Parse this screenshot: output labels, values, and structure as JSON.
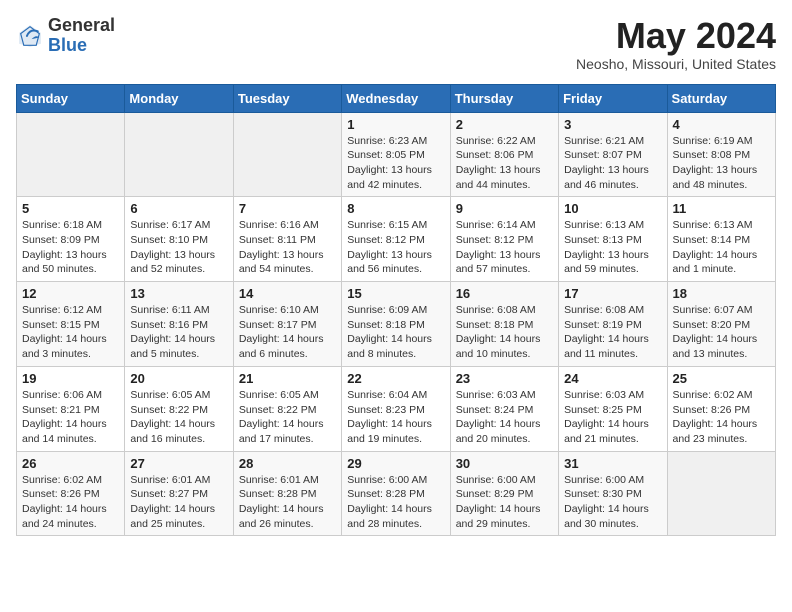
{
  "header": {
    "logo_line1": "General",
    "logo_line2": "Blue",
    "month_title": "May 2024",
    "location": "Neosho, Missouri, United States"
  },
  "weekdays": [
    "Sunday",
    "Monday",
    "Tuesday",
    "Wednesday",
    "Thursday",
    "Friday",
    "Saturday"
  ],
  "weeks": [
    [
      {
        "day": "",
        "sunrise": "",
        "sunset": "",
        "daylight": ""
      },
      {
        "day": "",
        "sunrise": "",
        "sunset": "",
        "daylight": ""
      },
      {
        "day": "",
        "sunrise": "",
        "sunset": "",
        "daylight": ""
      },
      {
        "day": "1",
        "sunrise": "Sunrise: 6:23 AM",
        "sunset": "Sunset: 8:05 PM",
        "daylight": "Daylight: 13 hours and 42 minutes."
      },
      {
        "day": "2",
        "sunrise": "Sunrise: 6:22 AM",
        "sunset": "Sunset: 8:06 PM",
        "daylight": "Daylight: 13 hours and 44 minutes."
      },
      {
        "day": "3",
        "sunrise": "Sunrise: 6:21 AM",
        "sunset": "Sunset: 8:07 PM",
        "daylight": "Daylight: 13 hours and 46 minutes."
      },
      {
        "day": "4",
        "sunrise": "Sunrise: 6:19 AM",
        "sunset": "Sunset: 8:08 PM",
        "daylight": "Daylight: 13 hours and 48 minutes."
      }
    ],
    [
      {
        "day": "5",
        "sunrise": "Sunrise: 6:18 AM",
        "sunset": "Sunset: 8:09 PM",
        "daylight": "Daylight: 13 hours and 50 minutes."
      },
      {
        "day": "6",
        "sunrise": "Sunrise: 6:17 AM",
        "sunset": "Sunset: 8:10 PM",
        "daylight": "Daylight: 13 hours and 52 minutes."
      },
      {
        "day": "7",
        "sunrise": "Sunrise: 6:16 AM",
        "sunset": "Sunset: 8:11 PM",
        "daylight": "Daylight: 13 hours and 54 minutes."
      },
      {
        "day": "8",
        "sunrise": "Sunrise: 6:15 AM",
        "sunset": "Sunset: 8:12 PM",
        "daylight": "Daylight: 13 hours and 56 minutes."
      },
      {
        "day": "9",
        "sunrise": "Sunrise: 6:14 AM",
        "sunset": "Sunset: 8:12 PM",
        "daylight": "Daylight: 13 hours and 57 minutes."
      },
      {
        "day": "10",
        "sunrise": "Sunrise: 6:13 AM",
        "sunset": "Sunset: 8:13 PM",
        "daylight": "Daylight: 13 hours and 59 minutes."
      },
      {
        "day": "11",
        "sunrise": "Sunrise: 6:13 AM",
        "sunset": "Sunset: 8:14 PM",
        "daylight": "Daylight: 14 hours and 1 minute."
      }
    ],
    [
      {
        "day": "12",
        "sunrise": "Sunrise: 6:12 AM",
        "sunset": "Sunset: 8:15 PM",
        "daylight": "Daylight: 14 hours and 3 minutes."
      },
      {
        "day": "13",
        "sunrise": "Sunrise: 6:11 AM",
        "sunset": "Sunset: 8:16 PM",
        "daylight": "Daylight: 14 hours and 5 minutes."
      },
      {
        "day": "14",
        "sunrise": "Sunrise: 6:10 AM",
        "sunset": "Sunset: 8:17 PM",
        "daylight": "Daylight: 14 hours and 6 minutes."
      },
      {
        "day": "15",
        "sunrise": "Sunrise: 6:09 AM",
        "sunset": "Sunset: 8:18 PM",
        "daylight": "Daylight: 14 hours and 8 minutes."
      },
      {
        "day": "16",
        "sunrise": "Sunrise: 6:08 AM",
        "sunset": "Sunset: 8:18 PM",
        "daylight": "Daylight: 14 hours and 10 minutes."
      },
      {
        "day": "17",
        "sunrise": "Sunrise: 6:08 AM",
        "sunset": "Sunset: 8:19 PM",
        "daylight": "Daylight: 14 hours and 11 minutes."
      },
      {
        "day": "18",
        "sunrise": "Sunrise: 6:07 AM",
        "sunset": "Sunset: 8:20 PM",
        "daylight": "Daylight: 14 hours and 13 minutes."
      }
    ],
    [
      {
        "day": "19",
        "sunrise": "Sunrise: 6:06 AM",
        "sunset": "Sunset: 8:21 PM",
        "daylight": "Daylight: 14 hours and 14 minutes."
      },
      {
        "day": "20",
        "sunrise": "Sunrise: 6:05 AM",
        "sunset": "Sunset: 8:22 PM",
        "daylight": "Daylight: 14 hours and 16 minutes."
      },
      {
        "day": "21",
        "sunrise": "Sunrise: 6:05 AM",
        "sunset": "Sunset: 8:22 PM",
        "daylight": "Daylight: 14 hours and 17 minutes."
      },
      {
        "day": "22",
        "sunrise": "Sunrise: 6:04 AM",
        "sunset": "Sunset: 8:23 PM",
        "daylight": "Daylight: 14 hours and 19 minutes."
      },
      {
        "day": "23",
        "sunrise": "Sunrise: 6:03 AM",
        "sunset": "Sunset: 8:24 PM",
        "daylight": "Daylight: 14 hours and 20 minutes."
      },
      {
        "day": "24",
        "sunrise": "Sunrise: 6:03 AM",
        "sunset": "Sunset: 8:25 PM",
        "daylight": "Daylight: 14 hours and 21 minutes."
      },
      {
        "day": "25",
        "sunrise": "Sunrise: 6:02 AM",
        "sunset": "Sunset: 8:26 PM",
        "daylight": "Daylight: 14 hours and 23 minutes."
      }
    ],
    [
      {
        "day": "26",
        "sunrise": "Sunrise: 6:02 AM",
        "sunset": "Sunset: 8:26 PM",
        "daylight": "Daylight: 14 hours and 24 minutes."
      },
      {
        "day": "27",
        "sunrise": "Sunrise: 6:01 AM",
        "sunset": "Sunset: 8:27 PM",
        "daylight": "Daylight: 14 hours and 25 minutes."
      },
      {
        "day": "28",
        "sunrise": "Sunrise: 6:01 AM",
        "sunset": "Sunset: 8:28 PM",
        "daylight": "Daylight: 14 hours and 26 minutes."
      },
      {
        "day": "29",
        "sunrise": "Sunrise: 6:00 AM",
        "sunset": "Sunset: 8:28 PM",
        "daylight": "Daylight: 14 hours and 28 minutes."
      },
      {
        "day": "30",
        "sunrise": "Sunrise: 6:00 AM",
        "sunset": "Sunset: 8:29 PM",
        "daylight": "Daylight: 14 hours and 29 minutes."
      },
      {
        "day": "31",
        "sunrise": "Sunrise: 6:00 AM",
        "sunset": "Sunset: 8:30 PM",
        "daylight": "Daylight: 14 hours and 30 minutes."
      },
      {
        "day": "",
        "sunrise": "",
        "sunset": "",
        "daylight": ""
      }
    ]
  ]
}
